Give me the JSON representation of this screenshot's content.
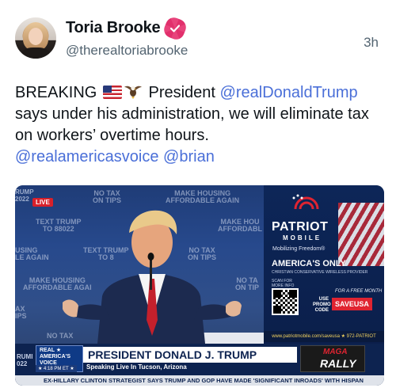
{
  "author": {
    "display_name": "Toria Brooke",
    "handle": "@therealtoriabrooke",
    "verified": true,
    "timestamp": "3h"
  },
  "post": {
    "prefix": "BREAKING",
    "emoji": [
      "us-flag",
      "eagle"
    ],
    "word_president": "President",
    "mention_trump": "@realDonaldTrump",
    "body": "says under his administration, we will eliminate tax on workers’ overtime hours.",
    "mention_voice": "@realamericasvoice",
    "mention_brian": "@brian"
  },
  "media": {
    "backdrop": {
      "live_badge": "LIVE",
      "corner_lines": [
        "RUMP",
        "2022"
      ],
      "signs": [
        "NO TAX\nON TIPS",
        "MAKE HOUSING\nAFFORDABLE AGAIN",
        "TEXT TRUMP\nTO 88022",
        "MAKE HOU\nAFFORDABL",
        "USING\nLE AGAIN",
        "TEXT TRUMP\nTO 8",
        "NO TAX\nON TIPS",
        "MAKE HOUSING\nAFFORDABLE AGAI",
        "NO TA\nON TIP",
        "AX\nIPS",
        "NO TAX",
        "UM"
      ]
    },
    "ad": {
      "brand": "PATRIOT",
      "brand_sub": "MOBILE",
      "tagline": "Mobilizing Freedom®",
      "headline": "AMERICA'S ONLY",
      "headline_sub": "CHRISTIAN CONSERVATIVE WIRELESS PROVIDER",
      "scan_text": "SCAN FOR MORE INFO",
      "free_month": "FOR A FREE MONTH",
      "use_promo": "USE PROMO CODE",
      "promo_code": "SAVEUSA",
      "url_line": "www.patriotmobile.com/saveusa ★ 972-PATRIOT"
    },
    "chyron": {
      "network": "REAL ★ AMERICA'S VOICE",
      "clock": "★ 4:18 PM ET ★",
      "side_tag": "RUMI\n022",
      "headline": "PRESIDENT DONALD J. TRUMP",
      "subline": "Speaking Live In Tucson, Arizona",
      "rally_top": "MAGA",
      "rally_bottom": "RALLY",
      "ticker": "EX-HILLARY CLINTON STRATEGIST SAYS TRUMP AND GOP HAVE MADE 'SIGNIFICANT INROADS' WITH HISPAN"
    }
  },
  "colors": {
    "link": "#4a6fd8",
    "verified": "#e1306c",
    "secondary_text": "#536471"
  }
}
